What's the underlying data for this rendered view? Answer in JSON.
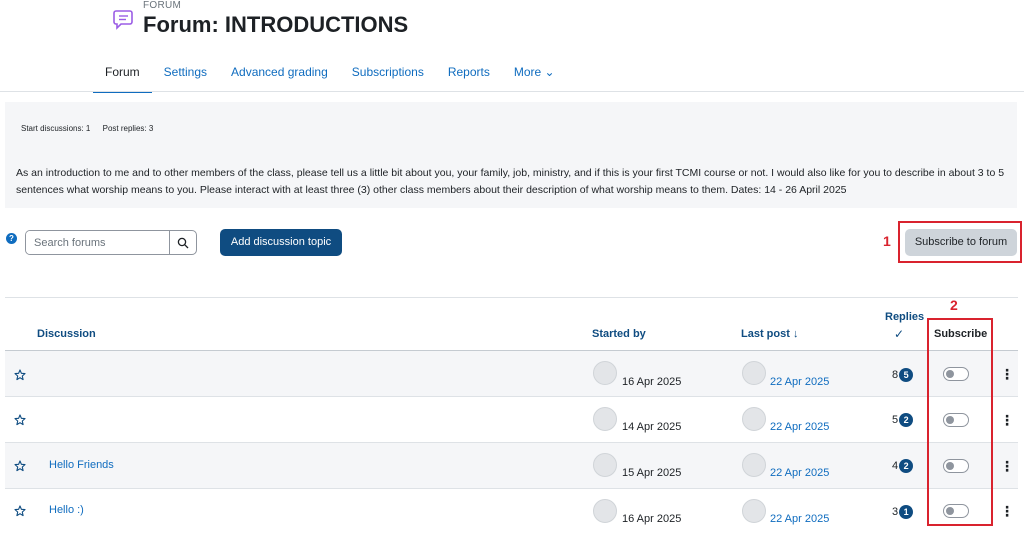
{
  "header": {
    "kicker": "FORUM",
    "title": "Forum: INTRODUCTIONS"
  },
  "nav": {
    "tabs": [
      {
        "label": "Forum",
        "active": true
      },
      {
        "label": "Settings"
      },
      {
        "label": "Advanced grading"
      },
      {
        "label": "Subscriptions"
      },
      {
        "label": "Reports"
      },
      {
        "label": "More ⌄"
      }
    ]
  },
  "completion": {
    "start_discussions": "Start discussions: 1",
    "post_replies": "Post replies: 3"
  },
  "intro": {
    "text": "As an introduction to me and to other members of the class, please tell us a little bit about you, your family, job, ministry, and if this is your first TCMI course or not. I would also like for you to describe in about 3 to 5 sentences what worship means to you. Please interact with at least three (3) other class members about their description of what worship means to them. Dates: 14 - 26 April 2025"
  },
  "toolbar": {
    "help_glyph": "?",
    "search_placeholder": "Search forums",
    "add_label": "Add discussion topic",
    "subscribe_label": "Subscribe to forum"
  },
  "annotations": {
    "one": "1",
    "two": "2"
  },
  "table": {
    "headers": {
      "discussion": "Discussion",
      "started_by": "Started by",
      "last_post": "Last post ↓",
      "replies": "Replies",
      "replies_check": "✓",
      "subscribe": "Subscribe"
    },
    "rows": [
      {
        "subject": "",
        "started": "16 Apr 2025",
        "last_post": "22 Apr 2025",
        "replies": "8",
        "unread": "5",
        "subscribed": false
      },
      {
        "subject": "",
        "started": "14 Apr 2025",
        "last_post": "22 Apr 2025",
        "replies": "5",
        "unread": "2",
        "subscribed": false
      },
      {
        "subject": "Hello Friends",
        "started": "15 Apr 2025",
        "last_post": "22 Apr 2025",
        "replies": "4",
        "unread": "2",
        "subscribed": false
      },
      {
        "subject": "Hello :)",
        "started": "16 Apr 2025",
        "last_post": "22 Apr 2025",
        "replies": "3",
        "unread": "1",
        "subscribed": false
      }
    ]
  },
  "colors": {
    "accent": "#0f6cbf",
    "primary_button": "#0f4c81",
    "annotation": "#d9232e"
  }
}
